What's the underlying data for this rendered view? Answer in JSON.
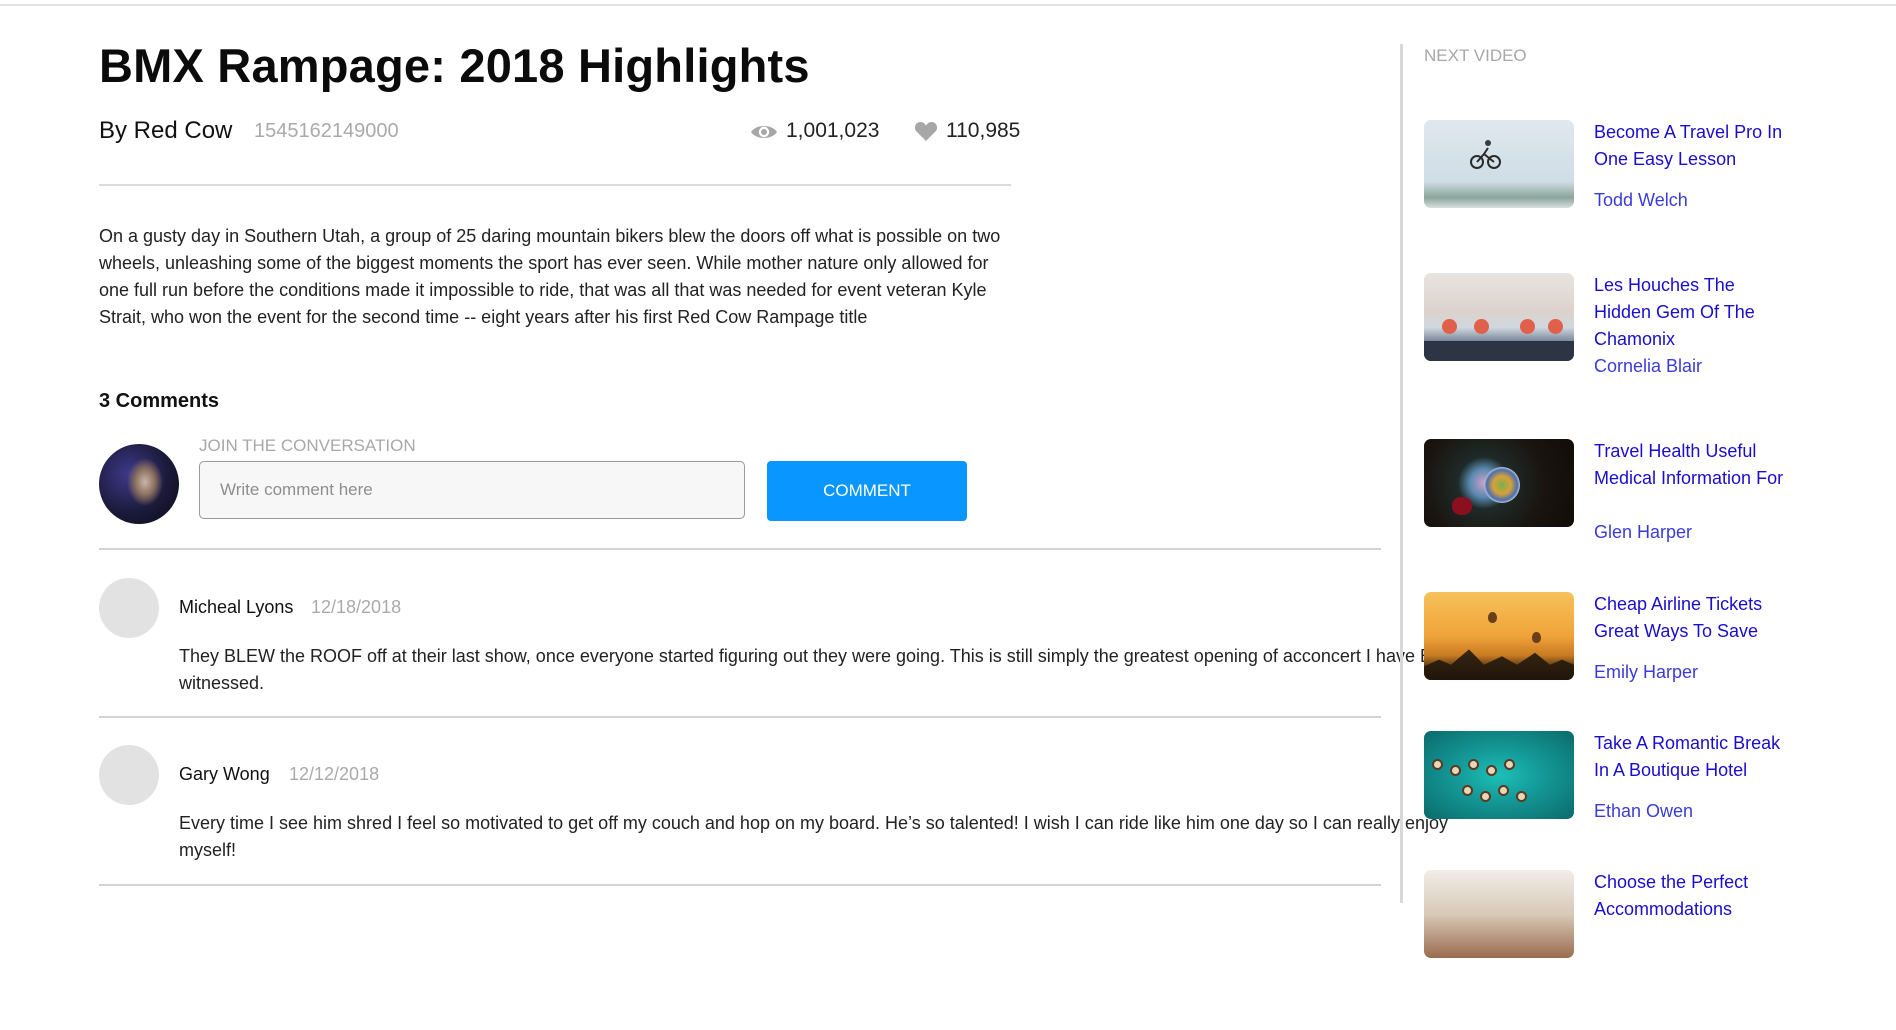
{
  "video": {
    "title": "BMX Rampage: 2018 Highlights",
    "byline": "By Red Cow",
    "timestamp": "1545162149000",
    "views": "1,001,023",
    "likes": "110,985",
    "description": "On a gusty day in Southern Utah, a group of 25 daring mountain bikers blew the doors off what is possible on two wheels, unleashing some of the biggest moments the sport has ever seen. While mother nature only allowed for one full run before the conditions made it impossible to ride, that was all that was needed for event veteran Kyle Strait, who won the event for the second time -- eight years after his first Red Cow Rampage title"
  },
  "comments_section": {
    "count_label": "3 Comments",
    "join_label": "JOIN THE CONVERSATION",
    "input_placeholder": "Write comment here",
    "input_value": "",
    "submit_label": "COMMENT",
    "items": [
      {
        "author": "Micheal Lyons",
        "date": "12/18/2018",
        "text": "They BLEW the ROOF off at their last show, once everyone started figuring out they were going. This is still simply the greatest opening of acconcert I have EVER witnessed."
      },
      {
        "author": "Gary Wong",
        "date": "12/12/2018",
        "text": "Every time I see him shred I feel so motivated to get off my couch and hop on my board. He’s so talented! I wish I can ride like him one day so I can really enjoy myself!"
      }
    ]
  },
  "sidebar": {
    "label": "NEXT VIDEO",
    "videos": [
      {
        "title": "Become A Travel Pro In One Easy Lesson",
        "author": "Todd Welch"
      },
      {
        "title": "Les Houches The Hidden Gem Of The Chamonix",
        "author": "Cornelia Blair"
      },
      {
        "title": "Travel Health Useful Medical Information For",
        "author": "Glen Harper"
      },
      {
        "title": "Cheap Airline Tickets Great Ways To Save",
        "author": "Emily Harper"
      },
      {
        "title": "Take A Romantic Break In A Boutique Hotel",
        "author": "Ethan Owen"
      },
      {
        "title": "Choose the Perfect Accommodations",
        "author": ""
      }
    ]
  },
  "colors": {
    "accent_button": "#0a96ff",
    "link_title": "#1a0dcd",
    "link_author": "#3b3bd8",
    "muted_text": "#aaaaaa"
  },
  "icons": {
    "views": "eye-icon",
    "likes": "heart-icon"
  }
}
